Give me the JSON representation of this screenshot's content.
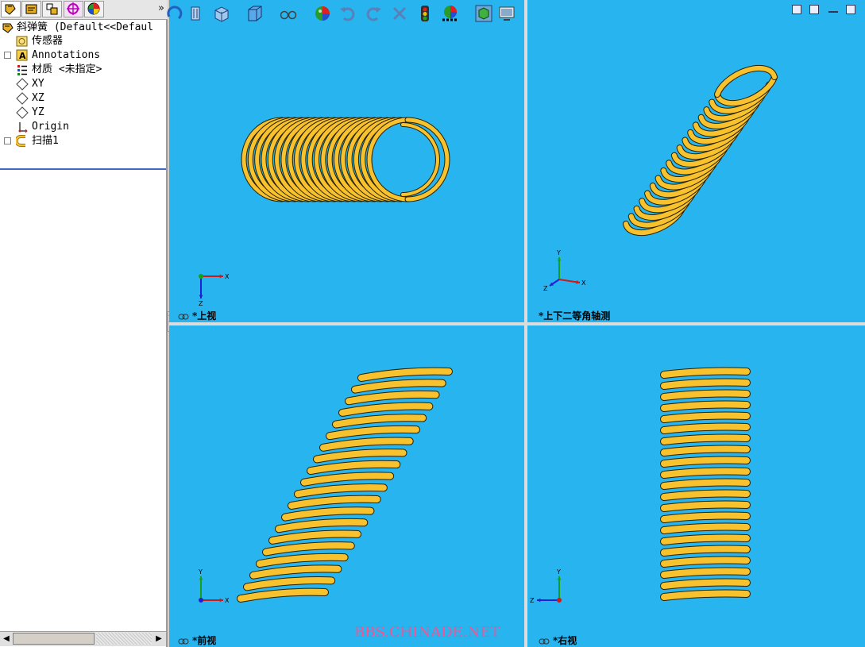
{
  "feature_tree": {
    "root": {
      "label": "斜弹簧  (Default<<Defaul"
    },
    "items": [
      {
        "label": "传感器",
        "icon": "sensor-icon",
        "expandable": false
      },
      {
        "label": "Annotations",
        "icon": "annotation-icon",
        "expandable": true
      },
      {
        "label": "材质 <未指定>",
        "icon": "material-icon",
        "expandable": false
      },
      {
        "label": "XY",
        "icon": "plane-icon",
        "expandable": false
      },
      {
        "label": "XZ",
        "icon": "plane-icon",
        "expandable": false
      },
      {
        "label": "YZ",
        "icon": "plane-icon",
        "expandable": false
      },
      {
        "label": "Origin",
        "icon": "origin-icon",
        "expandable": false
      },
      {
        "label": "扫描1",
        "icon": "sweep-icon",
        "expandable": true
      }
    ]
  },
  "panel_tabs": {
    "tabs": [
      "featuremanager-icon",
      "propertymanager-icon",
      "configurationmanager-icon",
      "dimxpert-icon",
      "display-manager-icon"
    ],
    "more": "»"
  },
  "toolbar": {
    "buttons": [
      "zoom-icon",
      "section-view-icon",
      "view-orientation-icon",
      "display-style-icon",
      "hide-show-icon",
      "appearance-icon",
      "undo-icon",
      "redo-icon",
      "close-icon",
      "traffic-light-icon",
      "scene-icon",
      "shaded-icon",
      "monitor-icon"
    ]
  },
  "viewports": {
    "top": {
      "label": "*上视"
    },
    "iso": {
      "label": "*上下二等角轴测"
    },
    "front": {
      "label": "*前视"
    },
    "right": {
      "label": "*右视"
    }
  },
  "triad": {
    "x": "X",
    "y": "Y",
    "z": "Z"
  },
  "watermark": "BBS.CHINADE.NET",
  "colors": {
    "viewport_bg": "#28b4ee",
    "spring": "#f8c12e",
    "spring_edge": "#2a2000",
    "x_axis": "#d01818",
    "y_axis": "#18a018",
    "z_axis": "#2020d0"
  }
}
